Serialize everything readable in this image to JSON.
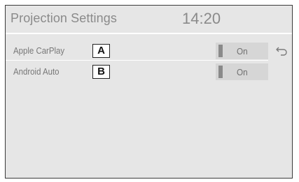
{
  "header": {
    "title": "Projection Settings",
    "clock": "14:20"
  },
  "settings": [
    {
      "label": "Apple CarPlay",
      "callout": "A",
      "value": "On"
    },
    {
      "label": "Android Auto",
      "callout": "B",
      "value": "On"
    }
  ],
  "icons": {
    "back": "back-arrow-icon"
  }
}
